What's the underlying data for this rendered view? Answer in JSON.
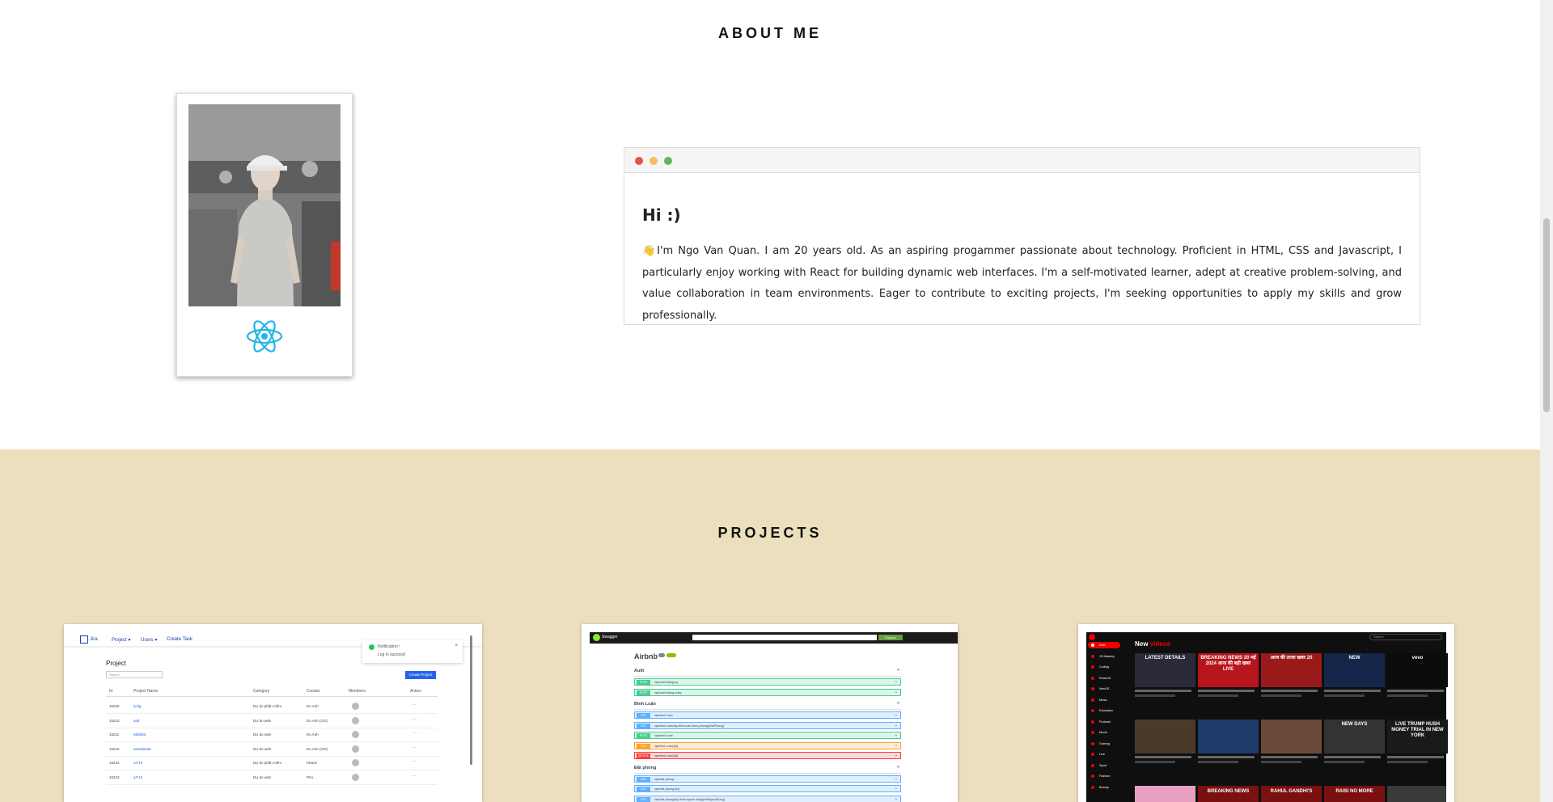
{
  "about": {
    "title": "ABOUT ME",
    "greeting": "Hi :)",
    "bio": "I'm Ngo Van Quan. I am 20 years old. As an aspiring progammer passionate about technology. Proficient in HTML, CSS and Javascript, I particularly enjoy working with React for building dynamic web interfaces. I'm a self-motivated learner, adept at creative problem-solving, and value collaboration in team environments. Eager to contribute to exciting projects, I'm seeking opportunities to apply my skills and grow professionally.",
    "bio_emoji": "👋",
    "window_dots": [
      "#e5534b",
      "#f2c05e",
      "#5cb85c"
    ],
    "photo_icon": "person-photo",
    "logo_icon": "react-logo-icon"
  },
  "projects": {
    "title": "PROJECTS",
    "jira": {
      "nav": [
        "Jira",
        "Project ▾",
        "Users ▾",
        "Create Task"
      ],
      "heading": "Project",
      "search_placeholder": "Search",
      "create_button": "Create Project",
      "toast_title": "Notification !",
      "toast_text": "Log in success!",
      "columns": [
        "Id",
        "Project Name",
        "Category",
        "Creator",
        "Members",
        "Action"
      ],
      "rows": [
        [
          "15206",
          "lo'dg",
          "Dự án phần mềm",
          "Do Anh"
        ],
        [
          "15210",
          "asd",
          "Dự án web",
          "Do Anh (OO)"
        ],
        [
          "15211",
          "555555",
          "Dự án web",
          "Do Anh"
        ],
        [
          "15216",
          "asasdasda",
          "Dự án web",
          "Do Anh (OO)"
        ],
        [
          "15222",
          "a7/10",
          "Dự án phần mềm",
          "Khanh"
        ],
        [
          "15223",
          "a7/10",
          "Dự án web",
          "Phu"
        ]
      ]
    },
    "swagger": {
      "brand": "Swagger",
      "explore_button": "Explore",
      "api_title": "Airbnb",
      "groups": [
        {
          "name": "Auth",
          "endpoints": [
            {
              "method": "POST",
              "path": "/api/auth/dang-ky",
              "color": "#49cc90"
            },
            {
              "method": "POST",
              "path": "/api/auth/dang-nhap",
              "color": "#49cc90"
            }
          ]
        },
        {
          "name": "Bình Luận",
          "endpoints": [
            {
              "method": "GET",
              "path": "/api/binh-luan",
              "color": "#61affe"
            },
            {
              "method": "GET",
              "path": "/api/binh-luan/lay-binh-luan-theo-phong/{MaPhong}",
              "color": "#61affe"
            },
            {
              "method": "POST",
              "path": "/api/binh-luan",
              "color": "#49cc90"
            },
            {
              "method": "PUT",
              "path": "/api/binh-luan/{id}",
              "color": "#fca130"
            },
            {
              "method": "DELETE",
              "path": "/api/binh-luan/{id}",
              "color": "#f93e3e"
            }
          ]
        },
        {
          "name": "Đặt phòng",
          "endpoints": [
            {
              "method": "GET",
              "path": "/api/dat-phong",
              "color": "#61affe"
            },
            {
              "method": "GET",
              "path": "/api/dat-phong/{id}",
              "color": "#61affe"
            },
            {
              "method": "GET",
              "path": "/api/dat-phong/lay-theo-nguoi-dung/{MaNguoiDung}",
              "color": "#61affe"
            }
          ]
        }
      ]
    },
    "youtube": {
      "search_placeholder": "Search",
      "heading_prefix": "New",
      "heading_suffix": "videos",
      "sidebar_items": [
        "New",
        "JS Mastery",
        "Coding",
        "ReactJS",
        "NextJS",
        "Music",
        "Education",
        "Podcast",
        "Movie",
        "Gaming",
        "Live",
        "Sport",
        "Fashion",
        "Beauty"
      ],
      "thumb_texts": [
        "LATEST DETAILS",
        "BREAKING NEWS 20 मई 2024 आज की बड़ी खबर LIVE",
        "आज की ताजा खबर 20",
        "NEW",
        "vevo",
        "",
        "",
        "",
        "NEW DAYS",
        "LIVE TRUMP HUSH MONEY TRIAL IN NEW YORK"
      ],
      "bottom_texts": [
        "BREAKING NEWS",
        "RAHUL GANDHI'S",
        "RAISI NO MORE"
      ]
    }
  }
}
